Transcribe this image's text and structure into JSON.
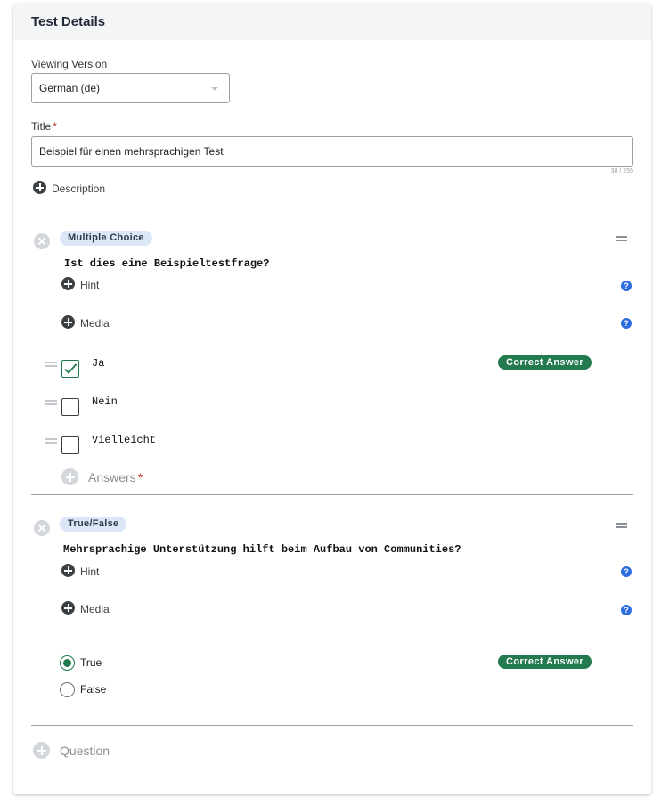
{
  "panel": {
    "title": "Test Details"
  },
  "viewing_version": {
    "label": "Viewing Version",
    "selected": "German (de)"
  },
  "title_field": {
    "label": "Title",
    "required_mark": "*",
    "value": "Beispiel für einen mehrsprachigen Test",
    "counter": "38 / 255"
  },
  "description_link": {
    "label": "Description"
  },
  "questions": [
    {
      "type": "Multiple Choice",
      "text": "Ist dies eine Beispieltestfrage?",
      "hint_label": "Hint",
      "media_label": "Media",
      "help_glyph": "?",
      "answers": [
        {
          "text": "Ja",
          "checked": true,
          "correct": true
        },
        {
          "text": "Nein",
          "checked": false,
          "correct": false
        },
        {
          "text": "Vielleicht",
          "checked": false,
          "correct": false
        }
      ],
      "correct_label": "Correct Answer",
      "add_answers_label": "Answers",
      "add_answers_required": "*"
    },
    {
      "type": "True/False",
      "text": "Mehrsprachige Unterstützung hilft beim Aufbau von Communities?",
      "hint_label": "Hint",
      "media_label": "Media",
      "help_glyph": "?",
      "options": [
        {
          "text": "True",
          "selected": true,
          "correct": true
        },
        {
          "text": "False",
          "selected": false,
          "correct": false
        }
      ],
      "correct_label": "Correct Answer"
    }
  ],
  "add_question": {
    "label": "Question"
  },
  "colors": {
    "accent_green": "#237a4f",
    "help_blue": "#2d6cdf",
    "badge_blue": "#dbe7f7"
  }
}
